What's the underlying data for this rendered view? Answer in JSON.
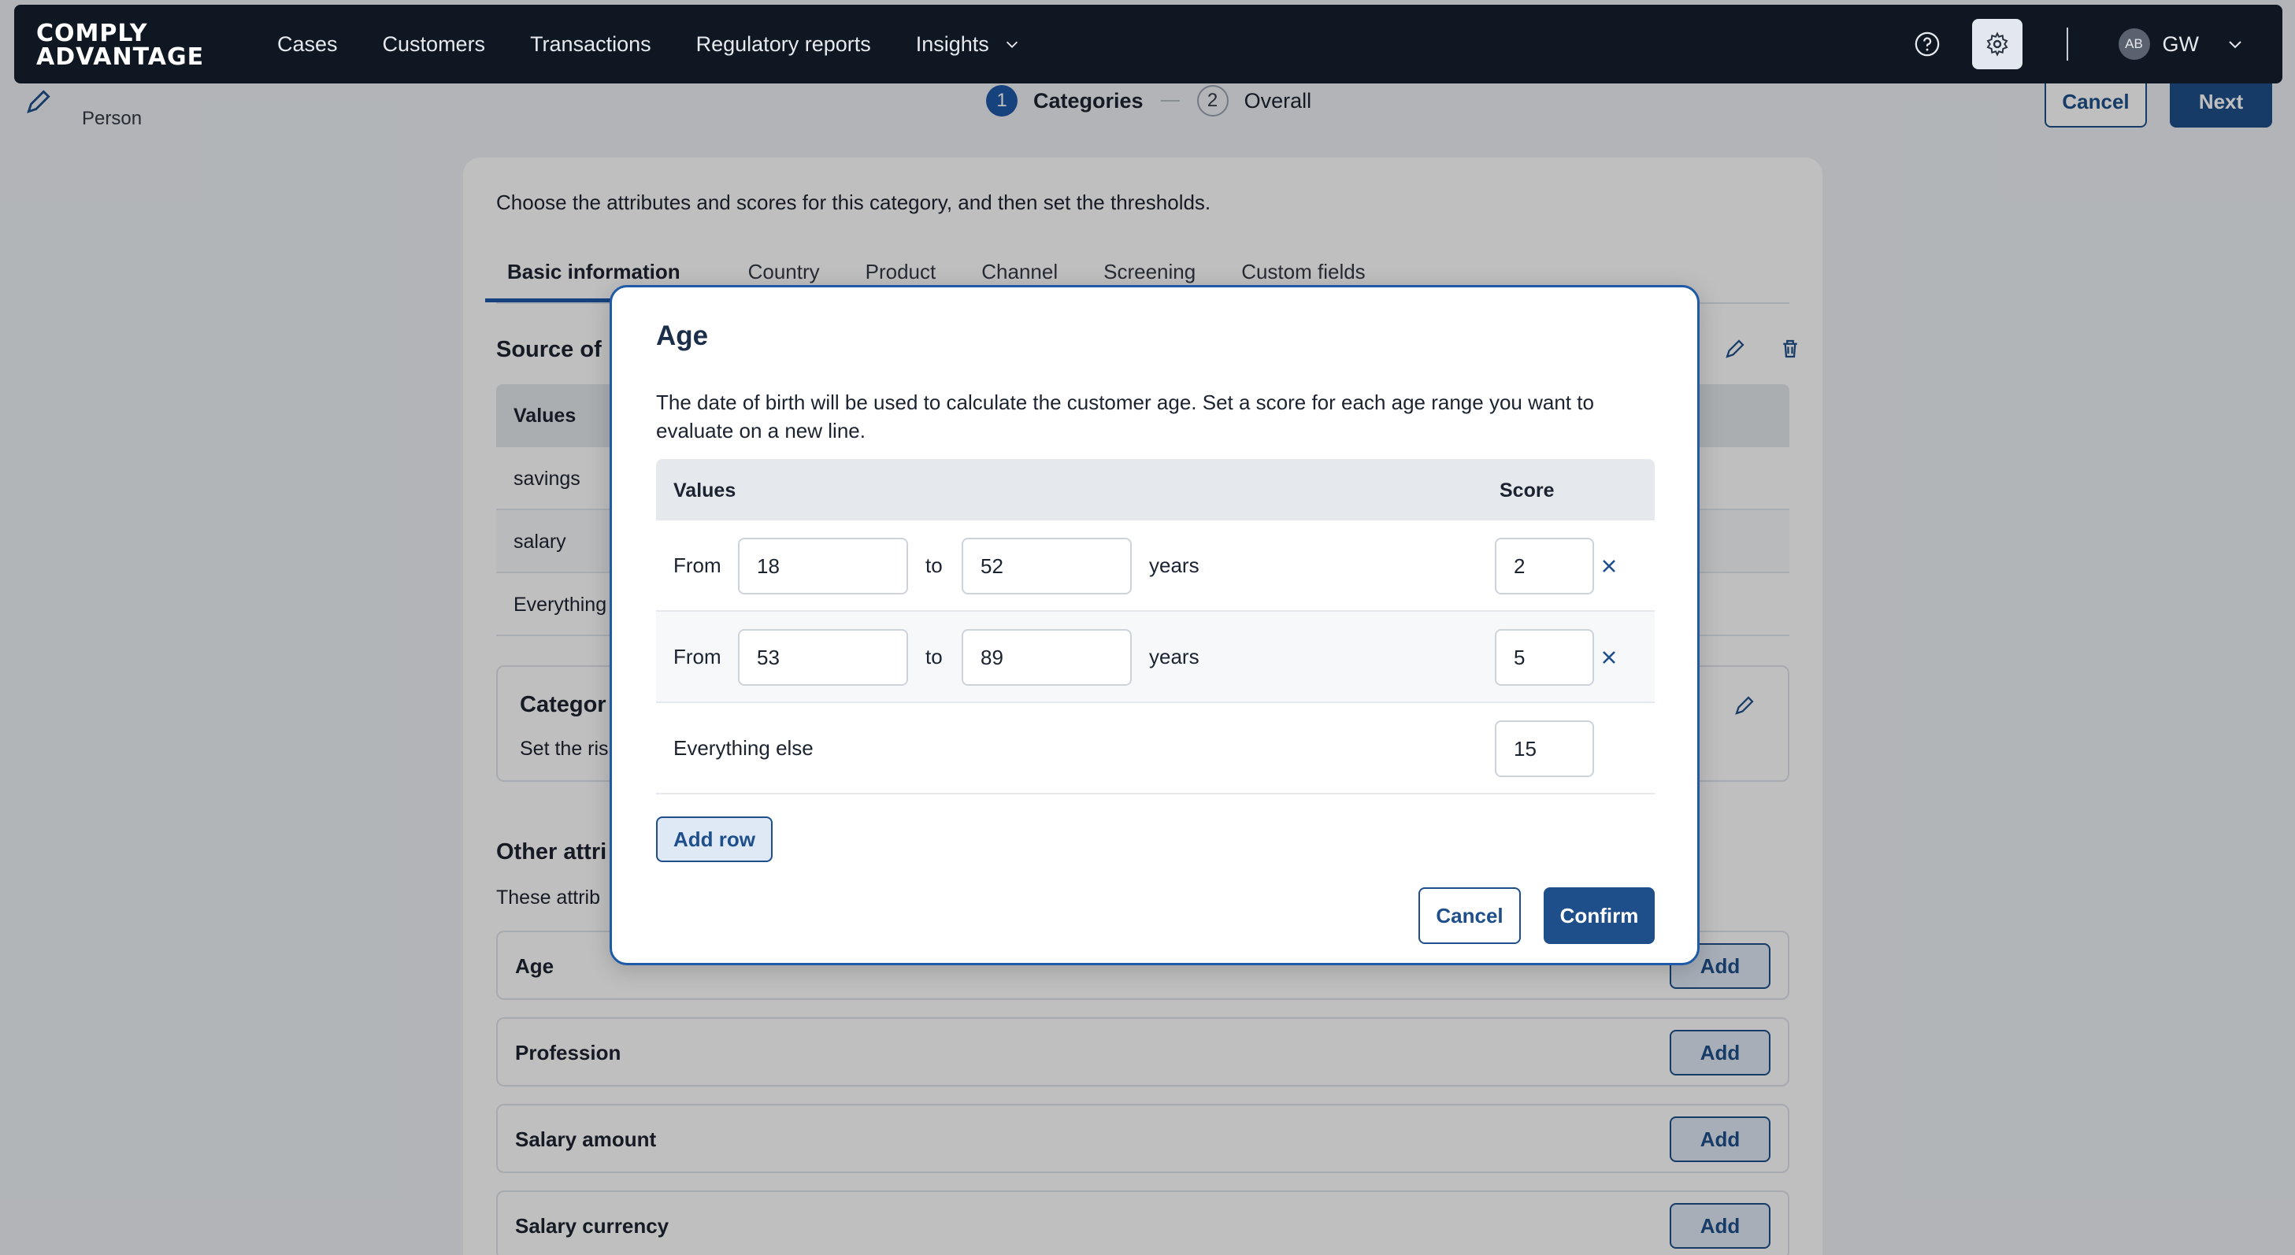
{
  "nav": {
    "logo_line1": "COMPLY",
    "logo_line2": "ADVANTAGE",
    "links": [
      "Cases",
      "Customers",
      "Transactions",
      "Regulatory reports",
      "Insights"
    ],
    "user_avatar": "AB",
    "user_initials": "GW"
  },
  "page": {
    "subtitle": "Person",
    "steps": [
      {
        "num": "1",
        "label": "Categories"
      },
      {
        "num": "2",
        "label": "Overall"
      }
    ],
    "cancel_label": "Cancel",
    "next_label": "Next",
    "intro": "Choose the attributes and scores for this category, and then set the thresholds.",
    "tabs": [
      "Basic information",
      "Country",
      "Product",
      "Channel",
      "Screening",
      "Custom fields"
    ],
    "section_source": "Source of",
    "values_header": "Values",
    "rows": [
      "savings",
      "salary",
      "Everything"
    ],
    "category_title": "Categor",
    "category_sub": "Set the ris",
    "other_title": "Other attri",
    "other_sub": "These attrib",
    "attributes": [
      "Age",
      "Profession",
      "Salary amount",
      "Salary currency"
    ],
    "add_label": "Add"
  },
  "modal": {
    "title": "Age",
    "description": "The date of birth will be used to calculate the customer age. Set a score for each age range you want to evaluate on a new line.",
    "col_values": "Values",
    "col_score": "Score",
    "from_label": "From",
    "to_label": "to",
    "unit_label": "years",
    "rows": [
      {
        "from": "18",
        "to": "52",
        "score": "2"
      },
      {
        "from": "53",
        "to": "89",
        "score": "5"
      }
    ],
    "else_label": "Everything else",
    "else_score": "15",
    "add_row_label": "Add row",
    "cancel_label": "Cancel",
    "confirm_label": "Confirm"
  },
  "colors": {
    "nav_bg": "#0f1722",
    "primary": "#1e4f8a",
    "accent_border": "#1e5aa8"
  },
  "icons": [
    "chevron-down-icon",
    "help-icon",
    "gear-icon",
    "pencil-icon",
    "trash-icon",
    "close-icon"
  ]
}
